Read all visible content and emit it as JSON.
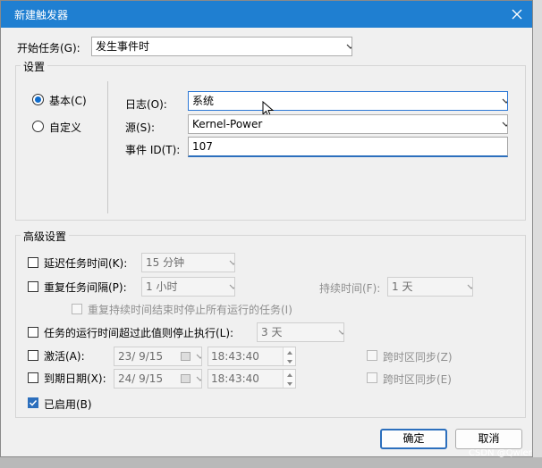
{
  "dialog": {
    "title": "新建触发器",
    "begin_task_label": "开始任务(G):",
    "begin_task_value": "发生事件时"
  },
  "settings": {
    "group_label": "设置",
    "radio_basic": "基本(C)",
    "radio_custom": "自定义",
    "log_label": "日志(O):",
    "log_value": "系统",
    "source_label": "源(S):",
    "source_value": "Kernel-Power",
    "event_id_label": "事件 ID(T):",
    "event_id_value": "107"
  },
  "advanced": {
    "group_label": "高级设置",
    "delay_label": "延迟任务时间(K):",
    "delay_value": "15 分钟",
    "repeat_label": "重复任务间隔(P):",
    "repeat_value": "1 小时",
    "duration_label": "持续时间(F):",
    "duration_value": "1 天",
    "stop_repeat_label": "重复持续时间结束时停止所有运行的任务(I)",
    "stop_long_label": "任务的运行时间超过此值则停止执行(L):",
    "stop_long_value": "3 天",
    "activate_label": "激活(A):",
    "activate_date": "23/  9/15",
    "activate_time": "18:43:40",
    "sync_tz_z": "跨时区同步(Z)",
    "expire_label": "到期日期(X):",
    "expire_date": "24/  9/15",
    "expire_time": "18:43:40",
    "sync_tz_e": "跨时区同步(E)",
    "enabled_label": "已启用(B)"
  },
  "buttons": {
    "ok": "确定",
    "cancel": "取消"
  },
  "watermark": "CSDN @Qwler",
  "colors": {
    "titlebar": "#1f7fd1",
    "accent": "#2c6fbd"
  }
}
